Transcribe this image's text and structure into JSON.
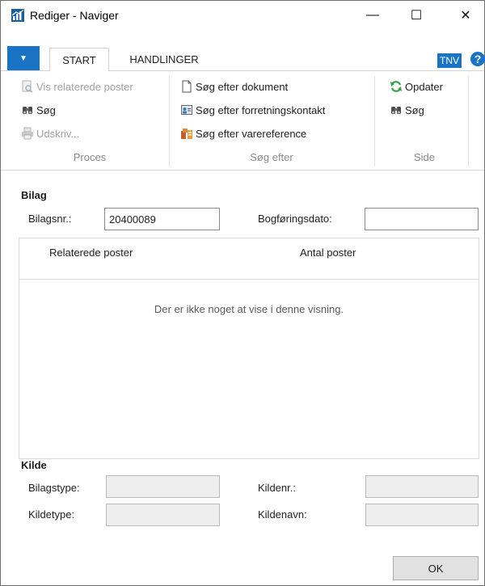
{
  "window": {
    "title": "Rediger - Naviger",
    "minimize_glyph": "—",
    "maximize_glyph": "☐",
    "close_glyph": "✕"
  },
  "ribbon": {
    "file_glyph": "▼",
    "tabs": [
      {
        "label": "START",
        "active": true
      },
      {
        "label": "HANDLINGER",
        "active": false
      }
    ],
    "tnv": "TNV",
    "help_glyph": "?",
    "groups": {
      "proces": {
        "label": "Proces",
        "items": [
          {
            "label": "Vis relaterede poster",
            "icon": "document-search-icon",
            "enabled": false
          },
          {
            "label": "Søg",
            "icon": "binoculars-icon",
            "enabled": true
          },
          {
            "label": "Udskriv...",
            "icon": "printer-icon",
            "enabled": false
          }
        ]
      },
      "soeg_efter": {
        "label": "Søg efter",
        "items": [
          {
            "label": "Søg efter dokument",
            "icon": "document-icon",
            "enabled": true
          },
          {
            "label": "Søg efter forretningskontakt",
            "icon": "contact-card-icon",
            "enabled": true
          },
          {
            "label": "Søg efter varereference",
            "icon": "item-reference-icon",
            "enabled": true
          }
        ]
      },
      "side": {
        "label": "Side",
        "items": [
          {
            "label": "Opdater",
            "icon": "refresh-icon",
            "enabled": true
          },
          {
            "label": "Søg",
            "icon": "binoculars-icon",
            "enabled": true
          }
        ]
      }
    }
  },
  "bilag": {
    "section_label": "Bilag",
    "bilagsnr_label": "Bilagsnr.:",
    "bilagsnr_value": "20400089",
    "bogfoeringsdato_label": "Bogføringsdato:",
    "bogfoeringsdato_value": ""
  },
  "grid": {
    "columns": [
      "Relaterede poster",
      "Antal poster"
    ],
    "empty_text": "Der er ikke noget at vise i denne visning."
  },
  "kilde": {
    "section_label": "Kilde",
    "bilagstype_label": "Bilagstype:",
    "bilagstype_value": "",
    "kildetype_label": "Kildetype:",
    "kildetype_value": "",
    "kildenr_label": "Kildenr.:",
    "kildenr_value": "",
    "kildenavn_label": "Kildenavn:",
    "kildenavn_value": ""
  },
  "ok_label": "OK",
  "colors": {
    "accent": "#1a74c6",
    "refresh_green": "#3aa14a",
    "disabled_text": "#a0a0a0"
  }
}
